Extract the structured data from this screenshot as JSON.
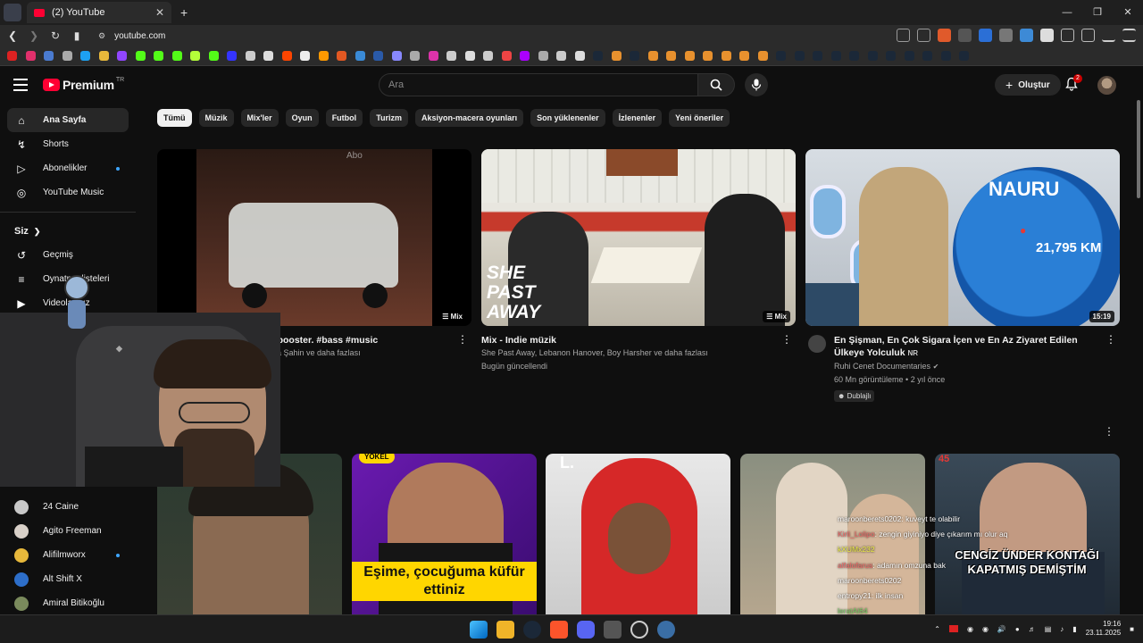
{
  "browser": {
    "tab_title": "(2) YouTube",
    "tab_close": "✕",
    "new_tab": "+",
    "url": "youtube.com",
    "window_controls": [
      "—",
      "❐",
      "✕"
    ]
  },
  "header": {
    "logo_text": "Premium",
    "logo_region": "TR",
    "search_placeholder": "Ara",
    "create_label": "Oluştur",
    "notification_count": "2"
  },
  "sidebar": {
    "main_items": [
      {
        "label": "Ana Sayfa",
        "icon": "home-icon"
      },
      {
        "label": "Shorts",
        "icon": "shorts-icon"
      },
      {
        "label": "Abonelikler",
        "icon": "subscriptions-icon"
      },
      {
        "label": "YouTube Music",
        "icon": "youtube-music-icon"
      }
    ],
    "you_section_title": "Siz",
    "you_items": [
      {
        "label": "Geçmiş",
        "icon": "history-icon"
      },
      {
        "label": "Oynatma listeleri",
        "icon": "playlists-icon"
      },
      {
        "label": "Videolarınız",
        "icon": "your-videos-icon"
      }
    ],
    "channels": [
      {
        "label": "24 Caine",
        "color": "#c8c8c8"
      },
      {
        "label": "Agito Freeman",
        "color": "#d8d0c8"
      },
      {
        "label": "Alifilmworx",
        "color": "#e7b83b"
      },
      {
        "label": "Alt Shift X",
        "color": "#2d6ec9"
      },
      {
        "label": "Amiral Bitikoğlu",
        "color": "#7a8a5c"
      }
    ]
  },
  "chips": [
    "Tümü",
    "Müzik",
    "Mix'ler",
    "Oyun",
    "Futbol",
    "Turizm",
    "Aksiyon-macera oyunları",
    "Son yüklenenler",
    "İzlenenler",
    "Yeni öneriler"
  ],
  "videos_row1": [
    {
      "title": "ss booster. #bass #music",
      "meta1": "a Şahin ve daha fazlası",
      "meta2": "",
      "badge": "Mix",
      "thumb_text": "Abo"
    },
    {
      "title": "Mix - Indie müzik",
      "meta1": "She Past Away, Lebanon Hanover, Boy Harsher ve daha fazlası",
      "meta2": "Bugün güncellendi",
      "badge": "Mix",
      "thumb_text": "SHE PAST AWAY"
    },
    {
      "title": "En Şişman, En Çok Sigara İçen ve En Az Ziyaret Edilen Ülkeye Yolculuk",
      "title_suffix": "NR",
      "channel": "Ruhi Cenet Documentaries",
      "meta2": "60 Mn görüntüleme • 2 yıl önce",
      "dub_label": "Dublajlı",
      "badge": "15:19",
      "thumb_label": "NAURU",
      "thumb_distance": "21,795 KM"
    }
  ],
  "videos_row2": [
    {
      "caption": ""
    },
    {
      "caption": "Eşime, çocuğuma küfür ettiniz",
      "tag": "YOKEL"
    },
    {
      "caption": "",
      "tag": "L."
    },
    {
      "caption": ""
    },
    {
      "caption": "CENGİZ ÜNDER KONTAĞI KAPATMIŞ DEMİŞTİM",
      "tag": "45"
    }
  ],
  "chat_overlay": [
    {
      "user": "maroonberets0202",
      "text": ": kuveyt te olabilir"
    },
    {
      "user": "Kirli_Lolipo",
      "text": ": zengin giyiniyo diye çıkarım mı olur aq"
    },
    {
      "user": "kXUMx232",
      "text": ""
    },
    {
      "user": "alfalofarus",
      "text": ": adamın omzuna bak"
    },
    {
      "user": "maroonberets0202",
      "text": ""
    },
    {
      "user": "entropy21",
      "text": ": ilk insan"
    },
    {
      "user": "leratAl64",
      "text": ""
    }
  ],
  "taskbar": {
    "time": "19:16",
    "date": "23.11.2025"
  }
}
